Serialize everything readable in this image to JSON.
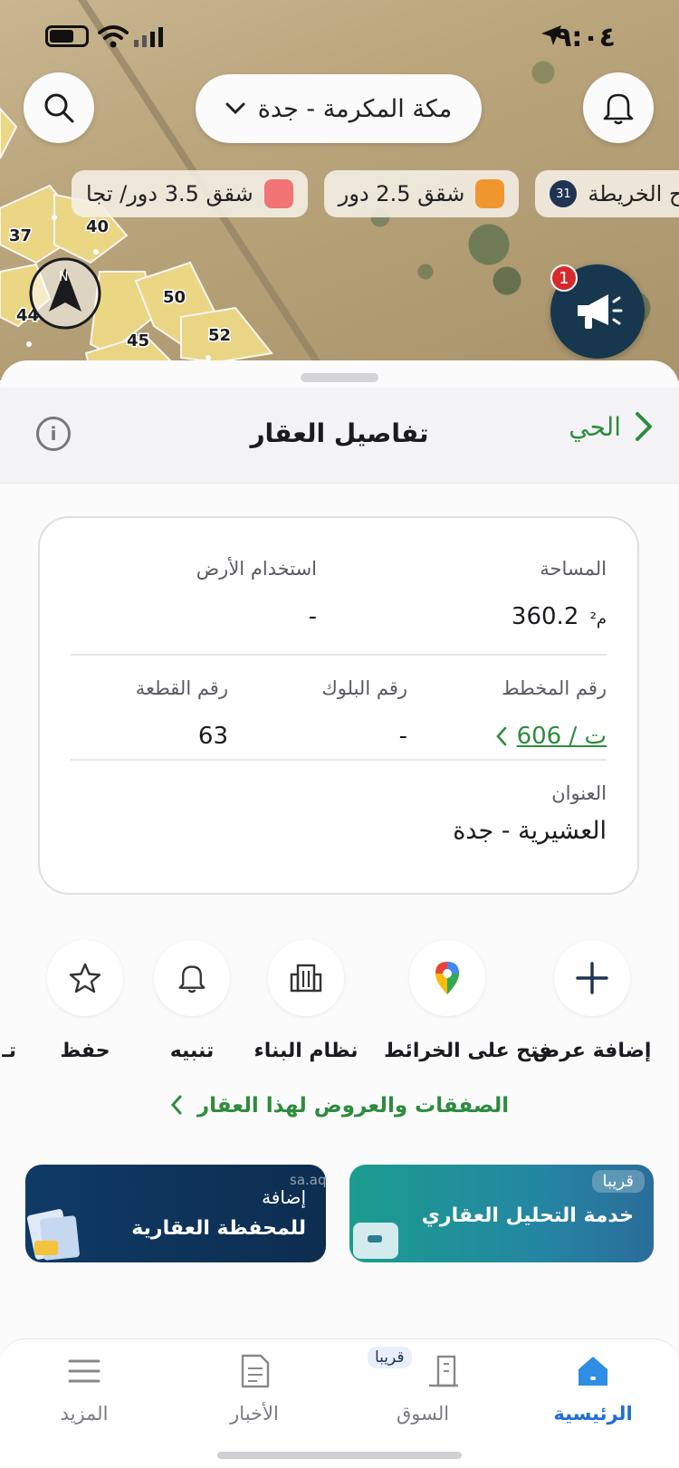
{
  "status_bar": {
    "time": "٩:٠٤"
  },
  "map": {
    "city_selector": "مكة المكرمة - جدة",
    "legend_chips": [
      {
        "label": "مفتاح الخريطة",
        "badge": "31"
      },
      {
        "label": "شقق 2.5 دور",
        "color": "#f0962f"
      },
      {
        "label": "شقق 3.5 دور/ تجا",
        "color": "#f07474"
      }
    ],
    "plot_numbers": [
      "37",
      "40",
      "44",
      "45",
      "50",
      "52"
    ],
    "compass_label": "N",
    "notification_badge": "1"
  },
  "sheet": {
    "title": "تفاصيل العقار",
    "back_label": "الحي",
    "info_icon": "i"
  },
  "details": {
    "area_label": "المساحة",
    "area_value": "360.2",
    "area_unit": "م²",
    "land_use_label": "استخدام الأرض",
    "land_use_value": "-",
    "plan_label": "رقم المخطط",
    "plan_value": "606 / ت",
    "block_label": "رقم البلوك",
    "block_value": "-",
    "plot_label": "رقم القطعة",
    "plot_value": "63",
    "address_label": "العنوان",
    "address_value": "العشيرية - جدة"
  },
  "actions": [
    {
      "label": "إضافة عرض",
      "icon": "plus-icon"
    },
    {
      "label": "فتح على الخرائط",
      "icon": "map-pin-icon"
    },
    {
      "label": "نظام البناء",
      "icon": "building-icon"
    },
    {
      "label": "تنبيه",
      "icon": "bell-icon"
    },
    {
      "label": "حفظ",
      "icon": "star-icon"
    },
    {
      "label": "تـ"
    }
  ],
  "deals_link": "الصفقات والعروض لهذا العقار",
  "banners": {
    "right": {
      "tag": "قريبا",
      "title": "خدمة التحليل العقاري"
    },
    "left": {
      "line1": "إضافة",
      "line2": "للمحفظة العقارية",
      "watermark": "sa.aqa"
    }
  },
  "tabbar": {
    "home": "الرئيسية",
    "market": "السوق",
    "market_badge": "قريبا",
    "news": "الأخبار",
    "more": "المزيد"
  }
}
